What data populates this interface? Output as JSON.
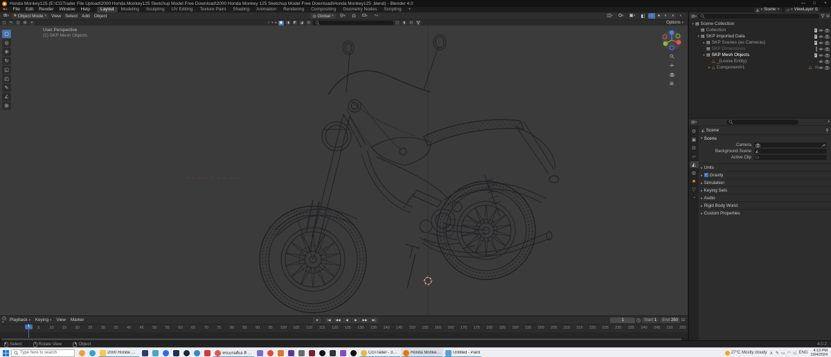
{
  "window": {
    "title": "Honda Monkey125 (E:\\CGTrader File Upload\\2000 Honda Monkey125 Sketchup Model Free Download\\2000 Honda Monkey 125 Sketchup Model Free Download\\Honda Monkey125 .blend) - Blender 4.0",
    "controls": [
      "minimize",
      "maximize",
      "close"
    ]
  },
  "topbar": {
    "menus": [
      "File",
      "Edit",
      "Render",
      "Window",
      "Help"
    ],
    "workspaces": [
      "Layout",
      "Modeling",
      "Sculpting",
      "UV Editing",
      "Texture Paint",
      "Shading",
      "Animation",
      "Rendering",
      "Compositing",
      "Geometry Nodes",
      "Scripting",
      "+"
    ],
    "active_workspace": "Layout",
    "scene_selector": {
      "label": "Scene"
    },
    "view_layer_selector": {
      "label": "ViewLayer"
    }
  },
  "viewport": {
    "header": {
      "mode": "Object Mode",
      "menus": [
        "View",
        "Select",
        "Add",
        "Object"
      ],
      "orientation": "Global",
      "shading_modes": [
        "wireframe",
        "solid",
        "material",
        "rendered"
      ],
      "active_shading": "wireframe"
    },
    "tool_settings": {
      "options_label": "Options"
    },
    "overlay": {
      "view_label": "User Perspective",
      "object_label": "(1) SKP Mesh Objects"
    },
    "toolbar": [
      "select-box",
      "cursor",
      "move",
      "rotate",
      "scale",
      "transform",
      "annotate",
      "measure",
      "add-cube"
    ],
    "nav_icons": [
      "zoom",
      "pan",
      "camera-view",
      "grid-ortho"
    ]
  },
  "outliner": {
    "rows": [
      {
        "label": "Scene Collection",
        "depth": 0,
        "expand": "open",
        "icon": "collection",
        "style": "normal",
        "right": []
      },
      {
        "label": "Collection",
        "depth": 1,
        "expand": "none",
        "icon": "collection",
        "style": "dim",
        "right": [
          "checkbox",
          "eye",
          "camera"
        ]
      },
      {
        "label": "SKP Imported Data",
        "depth": 1,
        "expand": "open",
        "icon": "collection",
        "style": "normal",
        "right": [
          "checkbox",
          "eye",
          "camera"
        ]
      },
      {
        "label": "SKP Scenes (as Cameras)",
        "depth": 2,
        "expand": "closed",
        "icon": "collection",
        "style": "dim",
        "right": [
          "checkbox",
          "eye",
          "camera"
        ]
      },
      {
        "label": "SKP Dimensions",
        "depth": 2,
        "expand": "none",
        "icon": "collection",
        "style": "excluded",
        "right": [
          "checkbox-empty",
          "eye",
          "camera"
        ]
      },
      {
        "label": "SKP Mesh Objects",
        "depth": 2,
        "expand": "open",
        "icon": "collection",
        "style": "selected",
        "right": [
          "checkbox",
          "eye",
          "camera"
        ]
      },
      {
        "label": "_(Loose Entity)",
        "depth": 3,
        "expand": "none",
        "icon": "mesh",
        "style": "dim",
        "right": [
          "eye",
          "camera"
        ]
      },
      {
        "label": "Component#1",
        "depth": 3,
        "expand": "closed",
        "icon": "mesh",
        "style": "dim",
        "badge": "15",
        "right": [
          "eye",
          "camera"
        ]
      }
    ]
  },
  "properties": {
    "tabs": [
      {
        "name": "tool"
      },
      {
        "name": "render"
      },
      {
        "name": "output"
      },
      {
        "name": "view-layer"
      },
      {
        "name": "scene",
        "active": true
      },
      {
        "name": "world"
      },
      {
        "name": "object"
      },
      {
        "name": "data"
      },
      {
        "name": "material"
      }
    ],
    "breadcrumb": "Scene",
    "scene_panel": {
      "title": "Scene",
      "fields": [
        {
          "label": "Camera",
          "icon": "camera",
          "value": "",
          "trailing": "eyedropper"
        },
        {
          "label": "Background Scene",
          "icon": "scene",
          "value": ""
        },
        {
          "label": "Active Clip",
          "icon": "clip",
          "value": ""
        }
      ]
    },
    "collapsed_panels": [
      {
        "label": "Units"
      },
      {
        "label": "Gravity",
        "checkbox": true
      },
      {
        "label": "Simulation"
      },
      {
        "label": "Keying Sets"
      },
      {
        "label": "Audio"
      },
      {
        "label": "Rigid Body World"
      },
      {
        "label": "Custom Properties"
      }
    ]
  },
  "timeline": {
    "menus": [
      {
        "label": "Playback",
        "dropdown": true
      },
      {
        "label": "Keying",
        "dropdown": true
      },
      {
        "label": "View"
      },
      {
        "label": "Marker"
      }
    ],
    "transport": [
      "jump-to-start",
      "prev-keyframe",
      "play-reverse",
      "play",
      "next-keyframe",
      "jump-to-end"
    ],
    "current_frame": "1",
    "start_label": "Start",
    "start_frame": "1",
    "end_label": "End",
    "end_frame": "250",
    "ruler": {
      "first": 5,
      "step": 5,
      "last": 255,
      "playhead_frame": 1
    }
  },
  "statusbar": {
    "hints": [
      {
        "button": "left",
        "label": "Select"
      },
      {
        "button": "middle",
        "label": "Rotate View"
      },
      {
        "button": "right",
        "label": "Object"
      }
    ],
    "version": "4.0.2"
  },
  "taskbar": {
    "search_placeholder": "Type here to search",
    "apps": [
      {
        "icon": "news-widget",
        "color": "#e8a33d",
        "shape": "round"
      },
      {
        "icon": "edge-browser",
        "color": "#35a3c8",
        "shape": "round"
      },
      {
        "icon": "file-explorer",
        "color": "#f5c84c",
        "label": "2000 Honda Monke...",
        "open": true
      },
      {
        "icon": "app-dark-blue",
        "color": "#2b3a67"
      },
      {
        "icon": "folder-teal",
        "color": "#4ba3c7"
      },
      {
        "icon": "edge-legacy",
        "color": "#1f6feb",
        "shape": "round"
      },
      {
        "icon": "app-navy",
        "color": "#20304f"
      },
      {
        "icon": "steam",
        "color": "#1b2838",
        "shape": "round"
      },
      {
        "icon": "app-blue-orb",
        "color": "#3b82d0",
        "shape": "round"
      },
      {
        "icon": "app-red-a",
        "color": "#d03b3b"
      },
      {
        "icon": "app-orange-circle",
        "color": "#e2574c",
        "shape": "round",
        "label": "ทรเมรอดิเอ ติ ท...",
        "open": true
      },
      {
        "icon": "photos",
        "color": "#7a6fd0"
      },
      {
        "icon": "chrome",
        "color": "#e8453c",
        "shape": "round"
      },
      {
        "icon": "app-orange",
        "color": "#d97a2b"
      },
      {
        "icon": "app-purple",
        "color": "#5b3a8e"
      },
      {
        "icon": "app-gray",
        "color": "#6b6b6b"
      },
      {
        "icon": "app-maroon",
        "color": "#7a1f2b"
      },
      {
        "icon": "opera",
        "color": "#111111",
        "shape": "round"
      },
      {
        "icon": "app-charcoal",
        "color": "#333333"
      },
      {
        "icon": "app-violet",
        "color": "#8549c7"
      },
      {
        "icon": "app-black-circle",
        "color": "#0f0f0f",
        "shape": "round"
      },
      {
        "icon": "chrome",
        "color": "#e8b93c",
        "shape": "round",
        "label": "CGTrader - 3D Mo...",
        "open": true
      },
      {
        "icon": "blender",
        "color": "#ea7600",
        "shape": "round",
        "label": "Honda Monkey125...",
        "open": true,
        "active": true
      },
      {
        "icon": "paint",
        "color": "#5aa0d8",
        "label": "Untitled - Paint",
        "open": true
      }
    ],
    "tray": {
      "temperature": "27°C",
      "condition": "Mostly cloudy",
      "chevron": "∧",
      "icons": [
        "pen",
        "battery",
        "network",
        "volume"
      ],
      "lang": "ENG",
      "time": "4:13 PM",
      "date": "10/4/2024"
    }
  },
  "colors": {
    "accent": "#4772b3",
    "object_orange": "#dd8a3c",
    "viewport_bg": "#3b3b3b"
  }
}
